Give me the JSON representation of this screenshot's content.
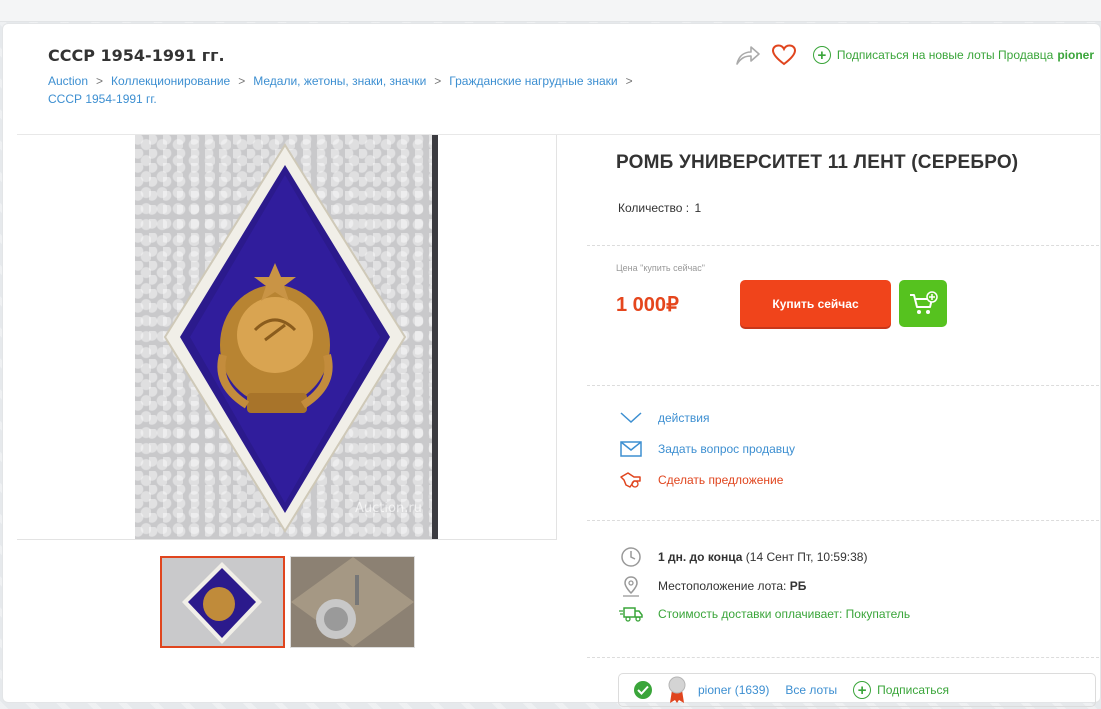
{
  "header": {
    "title": "СССР 1954-1991 гг.",
    "breadcrumb": [
      "Auction",
      "Коллекционирование",
      "Медали, жетоны, знаки, значки",
      "Гражданские нагрудные знаки",
      "СССР 1954-1991 гг."
    ],
    "breadcrumb_separator": ">",
    "subscribe_text": "Подписаться на новые лоты Продавца",
    "subscribe_seller": "pioner"
  },
  "gallery": {
    "watermark": "Auction.ru",
    "thumbnails": [
      "thumb-1",
      "thumb-2"
    ],
    "selected_index": 0
  },
  "lot": {
    "title": "РОМБ УНИВЕРСИТЕТ 11 ЛЕНТ (СЕРЕБРО)",
    "quantity_label": "Количество :",
    "quantity_value": "1",
    "price_label": "Цена \"купить сейчас\"",
    "price": "1 000",
    "currency": "₽",
    "buy_button": "Купить сейчас"
  },
  "actions": {
    "actions_label": "действия",
    "ask_seller": "Задать вопрос продавцу",
    "make_offer": "Сделать предложение"
  },
  "info": {
    "time_left": "1 дн. до конца",
    "end_date": "(14 Сент Пт, 10:59:38)",
    "location_label": "Местоположение лота:",
    "location_value": "РБ",
    "shipping": "Стоимость доставки оплачивает: Покупатель"
  },
  "seller": {
    "name_rating": "pioner (1639)",
    "all_lots": "Все лоты",
    "subscribe": "Подписаться"
  },
  "colors": {
    "accent_red": "#f0441b",
    "accent_green": "#56c21f",
    "link_blue": "#3d8fd1"
  }
}
